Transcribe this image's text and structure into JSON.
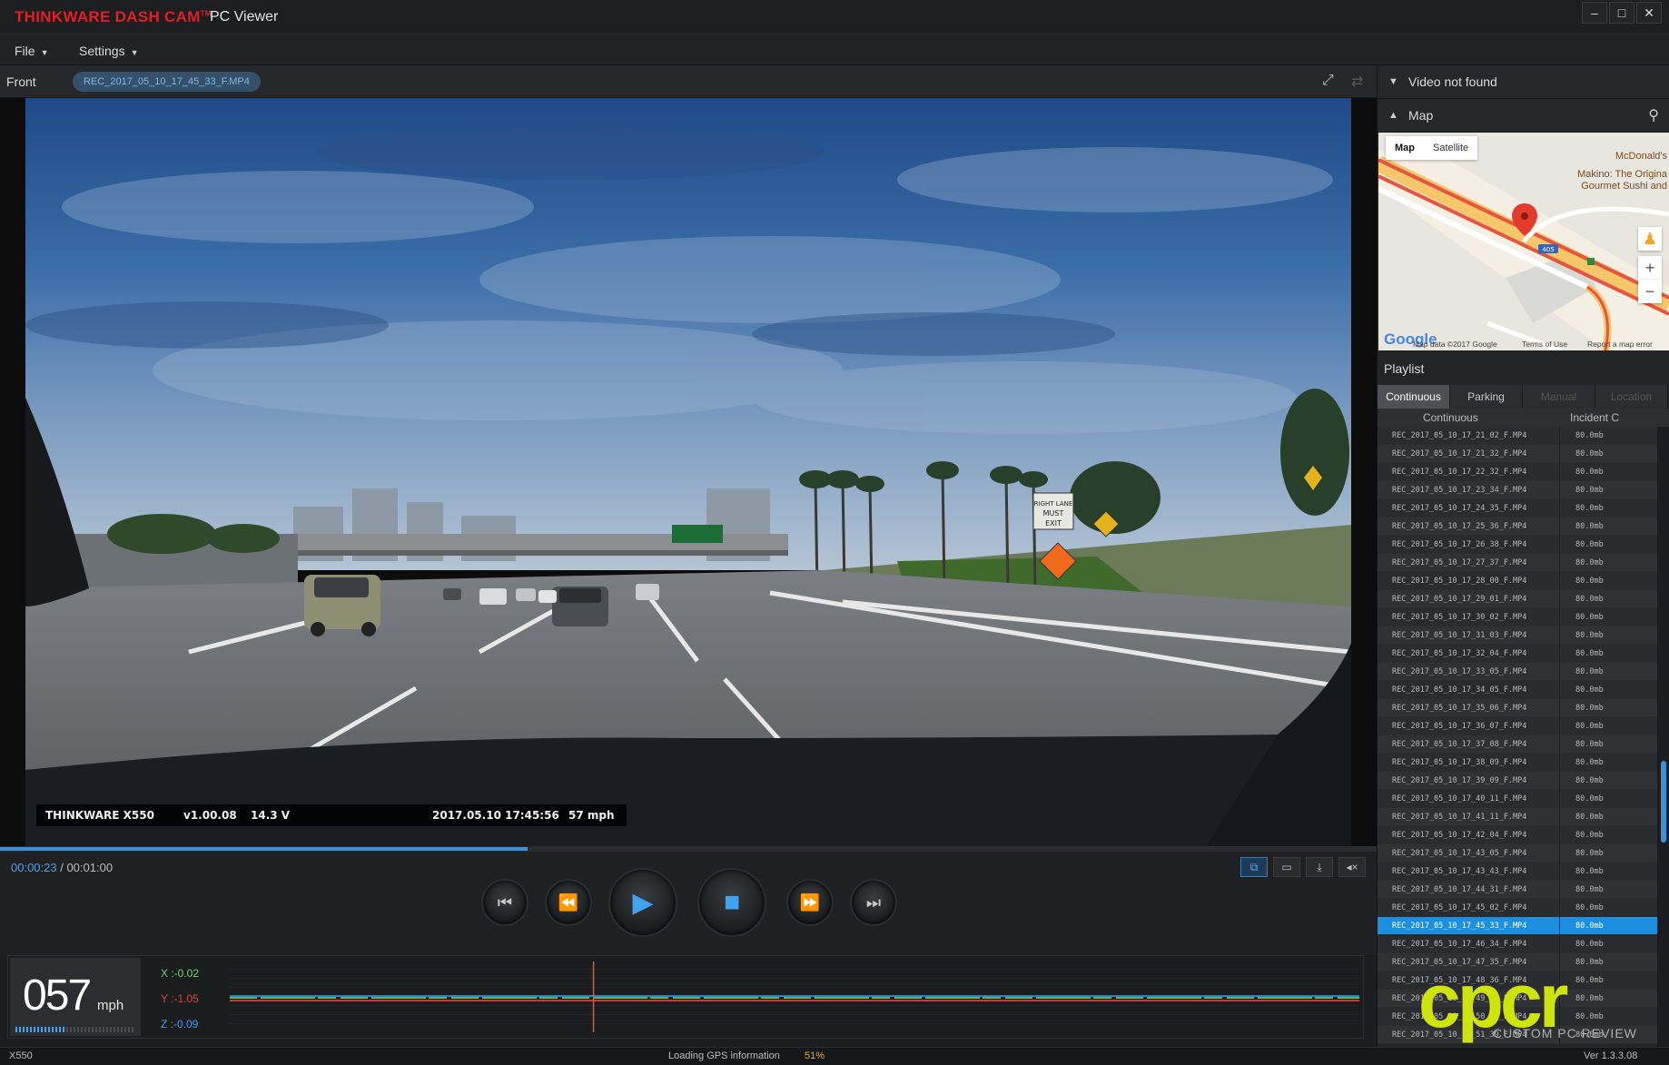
{
  "titlebar": {
    "brand": "THINKWARE DASH CAM",
    "trademark": "TM",
    "app_name": "PC Viewer",
    "minimize": "–",
    "maximize": "□",
    "close": "✕"
  },
  "menu": {
    "file": "File",
    "settings": "Settings"
  },
  "video_header": {
    "channel": "Front",
    "filename": "REC_2017_05_10_17_45_33_F.MP4"
  },
  "osd": {
    "model": "THINKWARE X550",
    "firmware": "v1.00.08",
    "voltage": "14.3 V",
    "datetime": "2017.05.10 17:45:56",
    "speed": "57 mph"
  },
  "playback": {
    "current_time": "00:00:23",
    "separator": " / ",
    "total_time": "00:01:00",
    "progress": 0.383
  },
  "gsensor": {
    "speed": "057",
    "speed_unit": "mph",
    "speed_level": 0.42,
    "x": "X :-0.02",
    "y": "Y :-1.05",
    "z": "Z :-0.09",
    "x_color": "#6bd46b",
    "y_color": "#e04040",
    "z_color": "#4a9ae8",
    "cursor_position": 0.322
  },
  "statusbar": {
    "model": "X550",
    "loading_text": "Loading GPS information",
    "loading_percent": "51%",
    "version": "Ver 1.3.3.08"
  },
  "right_panel": {
    "video_not_found": "Video not found",
    "map_header": "Map",
    "map": {
      "tab_map": "Map",
      "tab_satellite": "Satellite",
      "place_1": "McDonald's",
      "place_2a": "Makino: The Origina",
      "place_2b": "Gourmet Sushi and",
      "highway_shield": "405",
      "google": "Google",
      "map_data": "Map data ©2017 Google",
      "terms": "Terms of Use",
      "report": "Report a map error"
    },
    "playlist_header": "Playlist",
    "tabs": [
      "Continuous",
      "Parking",
      "Manual",
      "Location"
    ],
    "columns": [
      "Continuous",
      "Incident C"
    ],
    "files": [
      {
        "name": "REC_2017_05_10_17_21_02_F.MP4",
        "size": "80.0mb"
      },
      {
        "name": "REC_2017_05_10_17_21_32_F.MP4",
        "size": "80.0mb"
      },
      {
        "name": "REC_2017_05_10_17_22_32_F.MP4",
        "size": "80.0mb"
      },
      {
        "name": "REC_2017_05_10_17_23_34_F.MP4",
        "size": "80.0mb"
      },
      {
        "name": "REC_2017_05_10_17_24_35_F.MP4",
        "size": "80.0mb"
      },
      {
        "name": "REC_2017_05_10_17_25_36_F.MP4",
        "size": "80.0mb"
      },
      {
        "name": "REC_2017_05_10_17_26_38_F.MP4",
        "size": "80.0mb"
      },
      {
        "name": "REC_2017_05_10_17_27_37_F.MP4",
        "size": "80.0mb"
      },
      {
        "name": "REC_2017_05_10_17_28_00_F.MP4",
        "size": "80.0mb"
      },
      {
        "name": "REC_2017_05_10_17_29_01_F.MP4",
        "size": "80.0mb"
      },
      {
        "name": "REC_2017_05_10_17_30_02_F.MP4",
        "size": "80.0mb"
      },
      {
        "name": "REC_2017_05_10_17_31_03_F.MP4",
        "size": "80.0mb"
      },
      {
        "name": "REC_2017_05_10_17_32_04_F.MP4",
        "size": "80.0mb"
      },
      {
        "name": "REC_2017_05_10_17_33_05_F.MP4",
        "size": "80.0mb"
      },
      {
        "name": "REC_2017_05_10_17_34_05_F.MP4",
        "size": "80.0mb"
      },
      {
        "name": "REC_2017_05_10_17_35_06_F.MP4",
        "size": "80.0mb"
      },
      {
        "name": "REC_2017_05_10_17_36_07_F.MP4",
        "size": "80.0mb"
      },
      {
        "name": "REC_2017_05_10_17_37_08_F.MP4",
        "size": "80.0mb"
      },
      {
        "name": "REC_2017_05_10_17_38_09_F.MP4",
        "size": "80.0mb"
      },
      {
        "name": "REC_2017_05_10_17_39_09_F.MP4",
        "size": "80.0mb"
      },
      {
        "name": "REC_2017_05_10_17_40_11_F.MP4",
        "size": "80.0mb"
      },
      {
        "name": "REC_2017_05_10_17_41_11_F.MP4",
        "size": "80.0mb"
      },
      {
        "name": "REC_2017_05_10_17_42_04_F.MP4",
        "size": "80.0mb"
      },
      {
        "name": "REC_2017_05_10_17_43_05_F.MP4",
        "size": "80.0mb"
      },
      {
        "name": "REC_2017_05_10_17_43_43_F.MP4",
        "size": "80.0mb"
      },
      {
        "name": "REC_2017_05_10_17_44_31_F.MP4",
        "size": "80.0mb"
      },
      {
        "name": "REC_2017_05_10_17_45_02_F.MP4",
        "size": "80.0mb"
      },
      {
        "name": "REC_2017_05_10_17_45_33_F.MP4",
        "size": "80.0mb"
      },
      {
        "name": "REC_2017_05_10_17_46_34_F.MP4",
        "size": "80.0mb"
      },
      {
        "name": "REC_2017_05_10_17_47_35_F.MP4",
        "size": "80.0mb"
      },
      {
        "name": "REC_2017_05_10_17_48_36_F.MP4",
        "size": "80.0mb"
      },
      {
        "name": "REC_2017_05_10_17_49_37_F.MP4",
        "size": "80.0mb"
      },
      {
        "name": "REC_2017_05_10_17_50_38_F.MP4",
        "size": "80.0mb"
      },
      {
        "name": "REC_2017_05_10_17_51_39_F.MP4",
        "size": "80.0mb"
      }
    ],
    "selected_index": 27,
    "scroll_position": 0.62
  },
  "video_scene": {
    "sign_1": "RIGHT LANE",
    "sign_2": "MUST",
    "sign_3": "EXIT"
  },
  "watermark": {
    "logo": "cpcr",
    "tagline": "CUSTOM PC REVIEW"
  },
  "colors": {
    "accent": "#3fa3f0",
    "brand_red": "#e21f26",
    "selection": "#1d8fe0",
    "watermark": "#cfe40d"
  }
}
